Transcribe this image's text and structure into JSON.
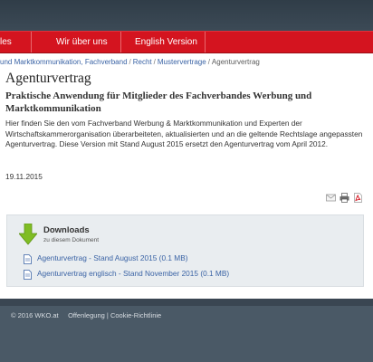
{
  "nav": {
    "items": [
      {
        "label": "les"
      },
      {
        "label": "Wir über uns"
      },
      {
        "label": "English Version"
      }
    ]
  },
  "breadcrumb": {
    "items": [
      "und Marktkommunikation, Fachverband",
      "Recht",
      "Mustervertrage"
    ],
    "current": "Agenturvertrag",
    "separator": "/"
  },
  "page": {
    "title": "Agenturvertrag",
    "subtitle": "Praktische Anwendung für Mitglieder des Fachverbandes Werbung und Marktkommunikation",
    "body": "Hier finden Sie den vom Fachverband Werbung & Marktkommunikation und Experten der Wirtschaftskammerorganisation überarbeiteten, aktualisierten und an die geltende Rechtslage angepassten Agenturvertrag. Diese Version mit Stand August 2015 ersetzt den Agenturvertrag vom April 2012.",
    "date": "19.11.2015"
  },
  "tools": {
    "icons": [
      "email-icon",
      "print-icon",
      "pdf-icon"
    ]
  },
  "downloads": {
    "title": "Downloads",
    "subtitle": "zu diesem Dokument",
    "items": [
      {
        "label": "Agenturvertrag - Stand August 2015 (0.1 MB)"
      },
      {
        "label": "Agenturvertrag englisch - Stand November 2015 (0.1 MB)"
      }
    ]
  },
  "footer": {
    "copyright": "© 2016 WKO.at",
    "links": [
      "Offenlegung",
      "Cookie-Richtlinie"
    ],
    "separator": "|"
  },
  "colors": {
    "nav_red": "#d4141f",
    "link_blue": "#3a63a5",
    "footer_bg": "#4a5966",
    "download_green": "#7fbd24"
  }
}
